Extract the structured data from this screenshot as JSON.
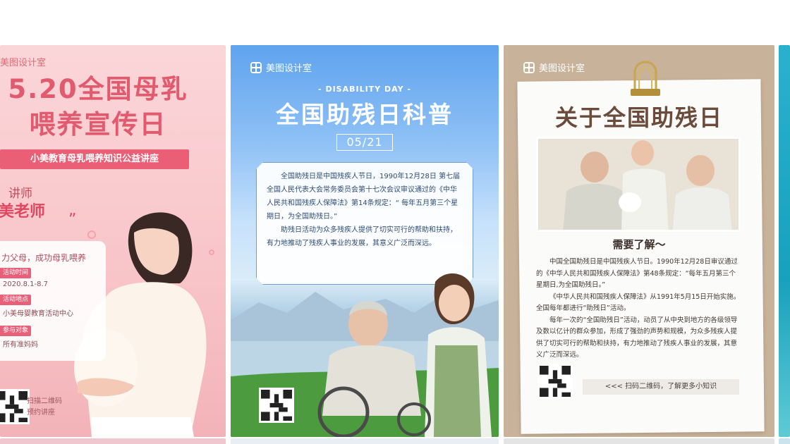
{
  "cards": [
    {
      "brand": "美图设计室",
      "title_line1": "5.20全国母乳",
      "title_line2": "喂养宣传日",
      "subtitle": "小美教育母乳喂养知识公益讲座",
      "lecturer_label": "讲师",
      "lecturer_name": "美老师",
      "slogan": "力父母，成功母乳喂养",
      "info": [
        {
          "tag": "活动时间",
          "value": "2020.8.1-8.7"
        },
        {
          "tag": "活动地点",
          "value": "小美母婴教育活动中心"
        },
        {
          "tag": "参与对象",
          "value": "所有准妈妈"
        }
      ],
      "scan_line1": "扫描二维码",
      "scan_line2": "预约讲座",
      "accent": "#e25a6e"
    },
    {
      "brand": "美图设计室",
      "eyebrow": "- DISABILITY DAY -",
      "title": "全国助残日科普",
      "date": "05/21",
      "paragraph1": "全国助残日是中国残疾人节日，1990年12月28日 第七届全国人民代表大会常务委员会第十七次会议审议通过的《中华人民共和国残疾人保障法》第14条规定：“ 每年五月第三个星期日，为全国助残日。”",
      "paragraph2": "助残日活动为众多残疾人提供了切实可行的帮助和扶持，有力地推动了残疾人事业的发展，其意义广泛而深远。",
      "accent": "#5fa3ee"
    },
    {
      "brand": "美图设计室",
      "title": "关于全国助残日",
      "learn_more": "需要了解～",
      "paragraph1": "中国全国助残日是中国残疾人节日。1990年12月28日审议通过的《中华人民共和国残疾人保障法》第48条规定：“每年五月第三个星期日,为全国助残日。”",
      "paragraph2": "《中华人民共和国残疾人保障法》从1991年5月15日开始实施。全国每年都进行“助残日”活动。",
      "paragraph3": "每年一次的“全国助残日”活动，动员了从中央到地方的各级领导及数以亿计的群众参加，形成了强劲的声势和规模，为众多残疾人提供了切实可行的帮助和扶持，有力地推动了残疾人事业的发展，其意义广泛而深远。",
      "scan": "<<<  扫码二维码，了解更多小知识",
      "accent": "#c9b29a"
    }
  ]
}
